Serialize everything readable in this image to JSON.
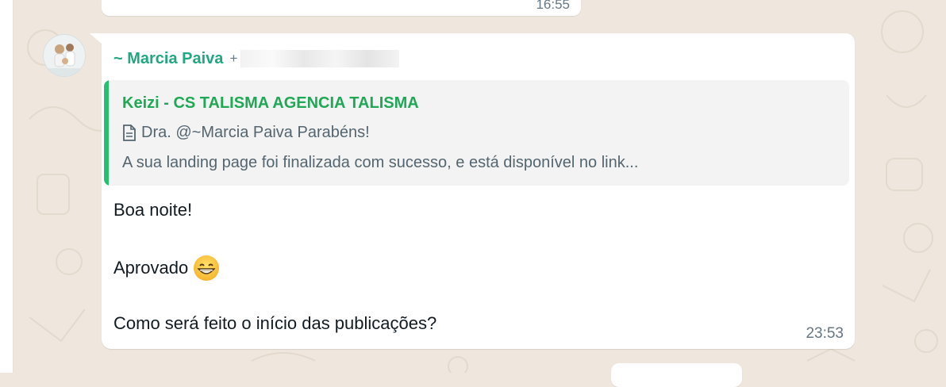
{
  "previous_message": {
    "time": "16:55"
  },
  "message": {
    "sender_name": "~ Marcia Paiva",
    "sender_plus": "+",
    "quote": {
      "author": "Keizi - CS TALISMA AGENCIA TALISMA",
      "icon": "document-icon",
      "line1": "Dra. @~Marcia Paiva  Parabéns!",
      "line2": "A sua landing page foi finalizada com sucesso, e está disponível no link..."
    },
    "lines": {
      "greeting": "Boa noite!",
      "approved": "Aprovado",
      "question": "Como será feito o início das publicações?"
    },
    "emoji": "grinning-face",
    "time": "23:53"
  },
  "colors": {
    "background": "#efe7dd",
    "sender": "#1fa882",
    "quote_accent": "#25c16f",
    "quote_author": "#1fa855"
  }
}
